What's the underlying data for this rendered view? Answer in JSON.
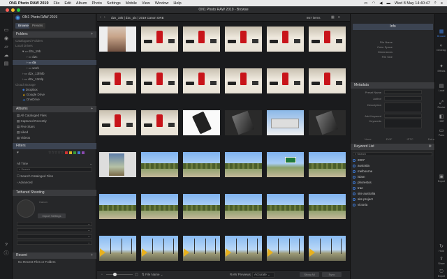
{
  "menubar": {
    "app": "ON1 Photo RAW 2019",
    "items": [
      "File",
      "Edit",
      "Album",
      "Photo",
      "Settings",
      "Mobile",
      "View",
      "Window",
      "Help"
    ],
    "clock": "Wed 8 May 14:40:47"
  },
  "window": {
    "title": "ON1 Photo RAW 2019 - Browse"
  },
  "left": {
    "app_title": "ON1 Photo RAW 2019",
    "tabs": [
      "Browse",
      "Presets"
    ],
    "folders_header": "Folders",
    "folder_rows": [
      "Catalogued Folders",
      "Local Drives",
      "d2x_19b",
      "d2c",
      "da",
      "work",
      "d2x_13hhlb",
      "d2x_13ntlp"
    ],
    "cloud_header": "Cloud Storage",
    "cloud_rows": [
      "Dropbox",
      "Google Drive",
      "OneDrive"
    ],
    "albums_header": "Albums",
    "album_rows": [
      "All Cataloged Files",
      "Captured Recently",
      "Five Stars",
      "Liked",
      "Videos"
    ],
    "filters_header": "Filters",
    "filter_time": "All Time",
    "filter_search": "Search",
    "filter_catalog": "Search Cataloged Files",
    "filter_advanced": "Advanced",
    "tether_header": "Tethered Shooting",
    "tether_camera": "Canon",
    "tether_import": "Import Settings",
    "recent_header": "Recent",
    "recent_text": "No Recent Files or Folders"
  },
  "toolbar": {
    "path": "d2x_19b  |  d2c_pix  |  2019 Canon ORE",
    "count": "867 items"
  },
  "bottombar": {
    "sort_label": "File Name",
    "raw_label": "RAW Previews",
    "raw_value": "Accurate",
    "btn1": "Show All",
    "btn2": "Sync"
  },
  "right": {
    "info_tab": "Info",
    "info_rows": [
      "File Name",
      "Color Space",
      "Dimensions",
      "File Size"
    ],
    "metadata_header": "Metadata",
    "metadata_rows": [
      "Preset Name",
      "Author",
      "Description",
      "Add Keyword",
      "Keywords"
    ],
    "meta_tabs": [
      "None",
      "EXIF",
      "IPTC",
      "Extra"
    ],
    "keyword_header": "Keyword List",
    "keyword_search": "Search",
    "keywords": [
      "2007",
      "australia",
      "melbourne",
      "islam",
      "phorestos",
      "trae",
      "site australia",
      "site project",
      "victoria"
    ]
  },
  "rightbar": [
    "Browse",
    "Develop",
    "Effects",
    "Local",
    "Resize",
    "HDR",
    "Pano",
    "Export"
  ],
  "rightbar_bottom": [
    "Hold",
    "Share",
    "Export"
  ],
  "colors": {
    "accent": "#3d7bd9",
    "selection": "#3c4452",
    "panel": "#262729",
    "header": "#3a3b3e"
  }
}
